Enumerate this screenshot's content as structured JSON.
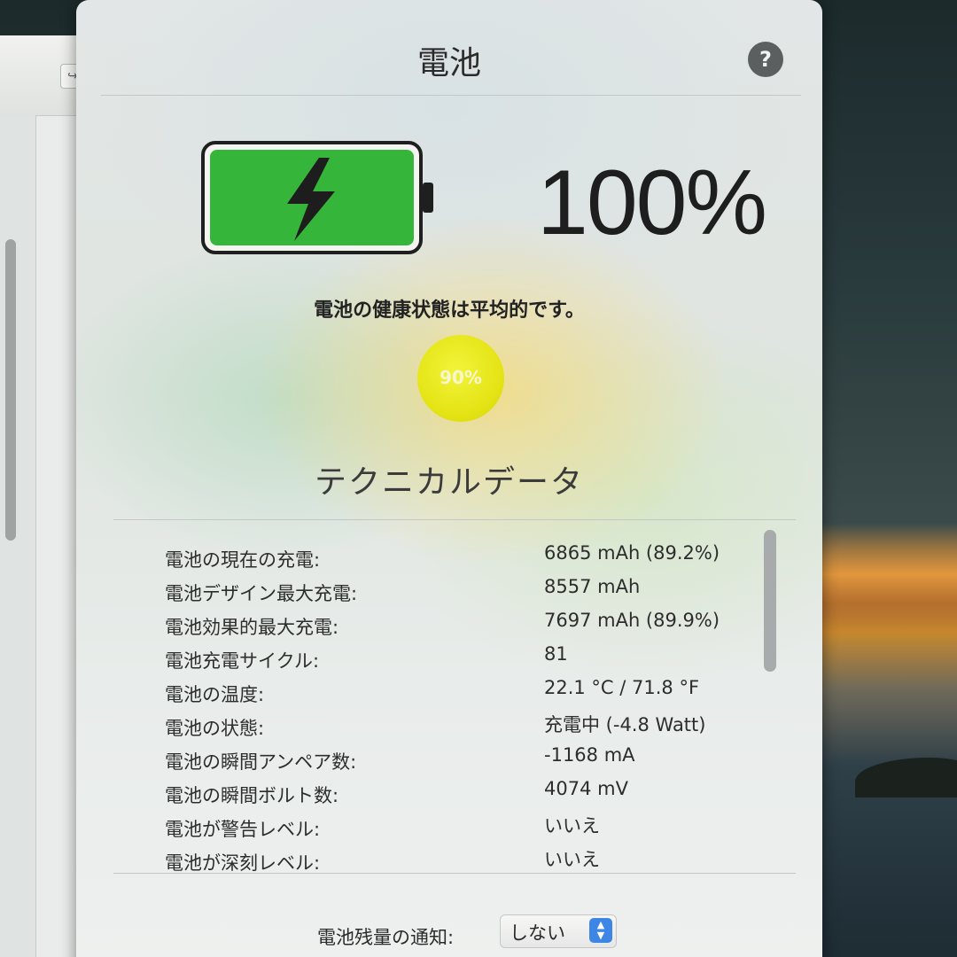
{
  "window": {
    "title": "電池",
    "help_label": "?"
  },
  "battery": {
    "charge_percent_text": "100%",
    "charge_level": 1.0,
    "fill_color": "#35b53a",
    "charging_icon": "lightning-bolt-icon",
    "health_text": "電池の健康状態は平均的です。",
    "health_percent_text": "90%",
    "health_color": "#e4e314"
  },
  "technical": {
    "heading": "テクニカルデータ",
    "rows": [
      {
        "label": "電池の現在の充電:",
        "value": "6865 mAh (89.2%)"
      },
      {
        "label": "電池デザイン最大充電:",
        "value": "8557 mAh"
      },
      {
        "label": "電池効果的最大充電:",
        "value": "7697 mAh (89.9%)"
      },
      {
        "label": "電池充電サイクル:",
        "value": "81"
      },
      {
        "label": "電池の温度:",
        "value": "22.1 °C / 71.8 °F"
      },
      {
        "label": "電池の状態:",
        "value": "充電中 (-4.8 Watt)"
      },
      {
        "label": "電池の瞬間アンペア数:",
        "value": "-1168 mA"
      },
      {
        "label": "電池の瞬間ボルト数:",
        "value": "4074 mV"
      },
      {
        "label": "電池が警告レベル:",
        "value": "いいえ"
      },
      {
        "label": "電池が深刻レベル:",
        "value": "いいえ"
      }
    ]
  },
  "notification": {
    "label": "電池残量の通知:",
    "selected": "しない"
  },
  "background": {
    "toolbar_button_icon": "share-icon"
  }
}
